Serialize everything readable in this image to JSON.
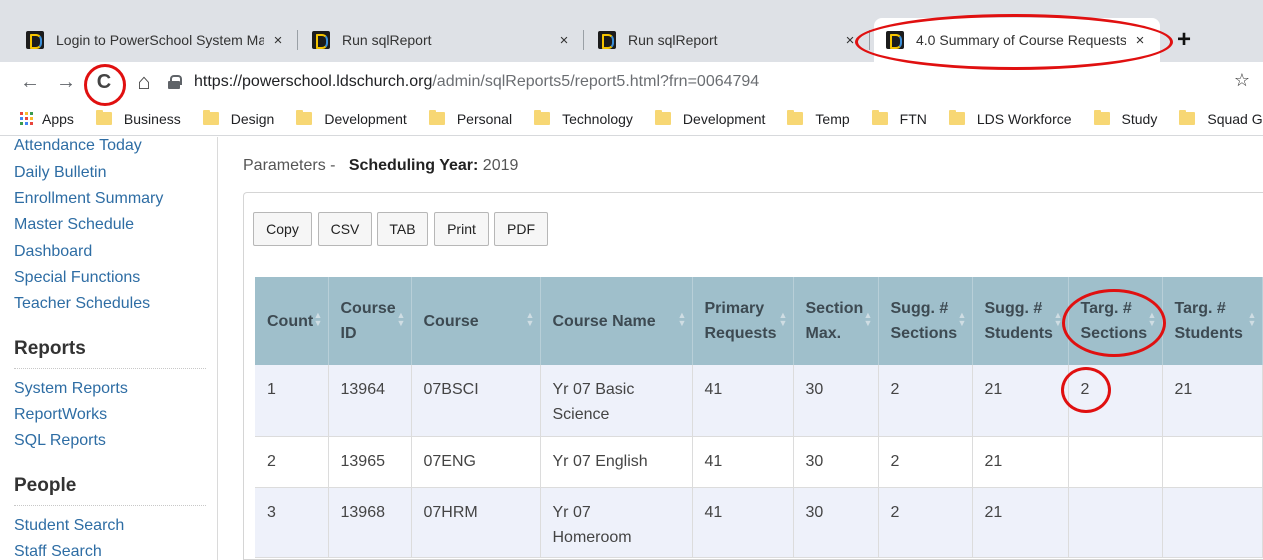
{
  "browser": {
    "tabs": [
      {
        "title": "Login to PowerSchool System Ma",
        "close": "×",
        "active": false
      },
      {
        "title": "Run sqlReport",
        "close": "×",
        "active": false
      },
      {
        "title": "Run sqlReport",
        "close": "×",
        "active": false
      },
      {
        "title": "4.0 Summary of Course Requests",
        "close": "×",
        "active": true
      }
    ],
    "new_tab": "+",
    "nav": {
      "back": "←",
      "forward": "→",
      "reload": "C",
      "home": "⌂"
    },
    "url_host": "https://powerschool.ldschurch.org",
    "url_path": "/admin/sqlReports5/report5.html?frn=0064794",
    "star": "☆",
    "bookmarks": [
      "Apps",
      "Business",
      "Design",
      "Development",
      "Personal",
      "Technology",
      "Development",
      "Temp",
      "FTN",
      "LDS Workforce",
      "Study",
      "Squad Go"
    ]
  },
  "sidebar": {
    "links_top": [
      "Attendance Today",
      "Daily Bulletin",
      "Enrollment Summary",
      "Master Schedule",
      "Dashboard",
      "Special Functions",
      "Teacher Schedules"
    ],
    "reports_heading": "Reports",
    "reports_links": [
      "System Reports",
      "ReportWorks",
      "SQL Reports"
    ],
    "people_heading": "People",
    "people_links": [
      "Student Search",
      "Staff Search"
    ]
  },
  "params": {
    "prefix": "Parameters -",
    "label": "Scheduling Year:",
    "value": "2019"
  },
  "export_buttons": [
    "Copy",
    "CSV",
    "TAB",
    "Print",
    "PDF"
  ],
  "table": {
    "headers": [
      [
        "Count"
      ],
      [
        "Course",
        "ID"
      ],
      [
        "Course"
      ],
      [
        "Course Name"
      ],
      [
        "Primary",
        "Requests"
      ],
      [
        "Section",
        "Max."
      ],
      [
        "Sugg. #",
        "Sections"
      ],
      [
        "Sugg. #",
        "Students"
      ],
      [
        "Targ. #",
        "Sections"
      ],
      [
        "Targ. #",
        "Students"
      ]
    ],
    "sort_glyph": "▲▼",
    "rows": [
      [
        [
          "1"
        ],
        [
          "13964"
        ],
        [
          "07BSCI"
        ],
        [
          "Yr 07 Basic",
          "Science"
        ],
        [
          "41"
        ],
        [
          "30"
        ],
        [
          "2"
        ],
        [
          "21"
        ],
        [
          "2"
        ],
        [
          "21"
        ]
      ],
      [
        [
          "2"
        ],
        [
          "13965"
        ],
        [
          "07ENG"
        ],
        [
          "Yr 07 English"
        ],
        [
          "41"
        ],
        [
          "30"
        ],
        [
          "2"
        ],
        [
          "21"
        ],
        [
          ""
        ],
        [
          ""
        ]
      ],
      [
        [
          "3"
        ],
        [
          "13968"
        ],
        [
          "07HRM"
        ],
        [
          "Yr 07",
          "Homeroom"
        ],
        [
          "41"
        ],
        [
          "30"
        ],
        [
          "2"
        ],
        [
          "21"
        ],
        [
          ""
        ],
        [
          ""
        ]
      ]
    ]
  },
  "colors": {
    "header_bg": "#9fbfcb",
    "odd_row_bg": "#eef1fa",
    "link": "#2e6da4",
    "annotation_red": "#e01010"
  }
}
